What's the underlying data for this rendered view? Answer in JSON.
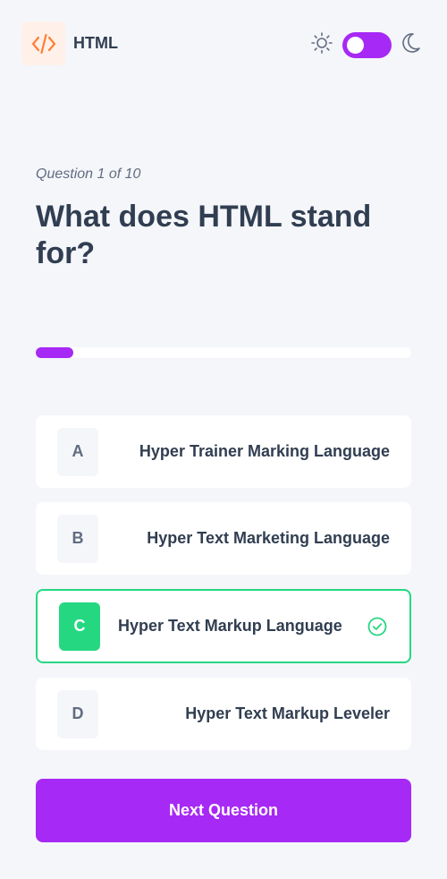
{
  "header": {
    "subject_title": "HTML",
    "subject_icon": "code-icon",
    "theme": {
      "light_icon": "sun-icon",
      "dark_icon": "moon-icon",
      "dark_mode": true
    }
  },
  "question": {
    "counter": "Question 1 of 10",
    "text": "What does HTML stand for?",
    "progress_fraction": 0.1
  },
  "options": [
    {
      "letter": "A",
      "text": "Hyper Trainer Marking Language",
      "state": "default"
    },
    {
      "letter": "B",
      "text": "Hyper Text Marketing Language",
      "state": "default"
    },
    {
      "letter": "C",
      "text": "Hyper Text Markup Language",
      "state": "correct"
    },
    {
      "letter": "D",
      "text": "Hyper Text Markup Leveler",
      "state": "default"
    }
  ],
  "next_button_label": "Next Question",
  "colors": {
    "accent": "#a729f5",
    "correct": "#26d782",
    "background": "#f4f6fa",
    "text": "#313e51",
    "muted": "#626c7f",
    "icon_bg": "#fff1e9",
    "icon_fg": "#ff7e35"
  }
}
